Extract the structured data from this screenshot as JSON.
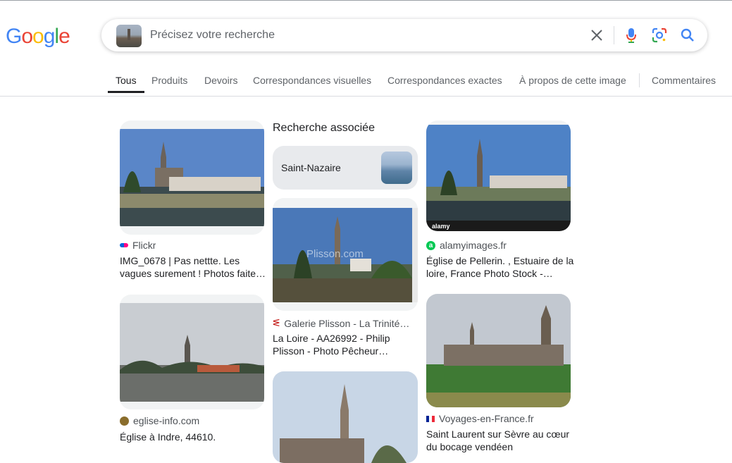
{
  "logo": {
    "letters": [
      "G",
      "o",
      "o",
      "g",
      "l",
      "e"
    ]
  },
  "search": {
    "placeholder": "Précisez votre recherche"
  },
  "tabs": [
    {
      "label": "Tous",
      "active": true
    },
    {
      "label": "Produits"
    },
    {
      "label": "Devoirs"
    },
    {
      "label": "Correspondances visuelles"
    },
    {
      "label": "Correspondances exactes"
    },
    {
      "label": "À propos de cette image"
    },
    {
      "label": "Commentaires"
    }
  ],
  "related": {
    "heading": "Recherche associée",
    "label": "Saint-Nazaire"
  },
  "results": [
    {
      "source": "Flickr",
      "title_line1": "IMG_0678 | Pas nettte. Les",
      "title_line2": "vagues surement ! Photos faite…"
    },
    {
      "source": "eglise-info.com",
      "title_line1": "Église à Indre, 44610.",
      "title_line2": ""
    },
    {
      "source": "Galerie Plisson - La Trinité…",
      "title_line1": "La Loire - AA26992 - Philip",
      "title_line2": "Plisson - Photo Pêcheur…",
      "watermark": "Plisson.com"
    },
    {
      "source": "alamyimages.fr",
      "title_line1": "Église de Pellerin. , Estuaire de la",
      "title_line2": "loire, France Photo Stock -…",
      "watermark": "alamy"
    },
    {
      "source": "Voyages-en-France.fr",
      "title_line1": "Saint Laurent sur Sèvre au cœur",
      "title_line2": "du bocage vendéen"
    }
  ],
  "colors": {
    "accent": "#1a73e8",
    "text": "#202124",
    "muted": "#5f6368"
  }
}
